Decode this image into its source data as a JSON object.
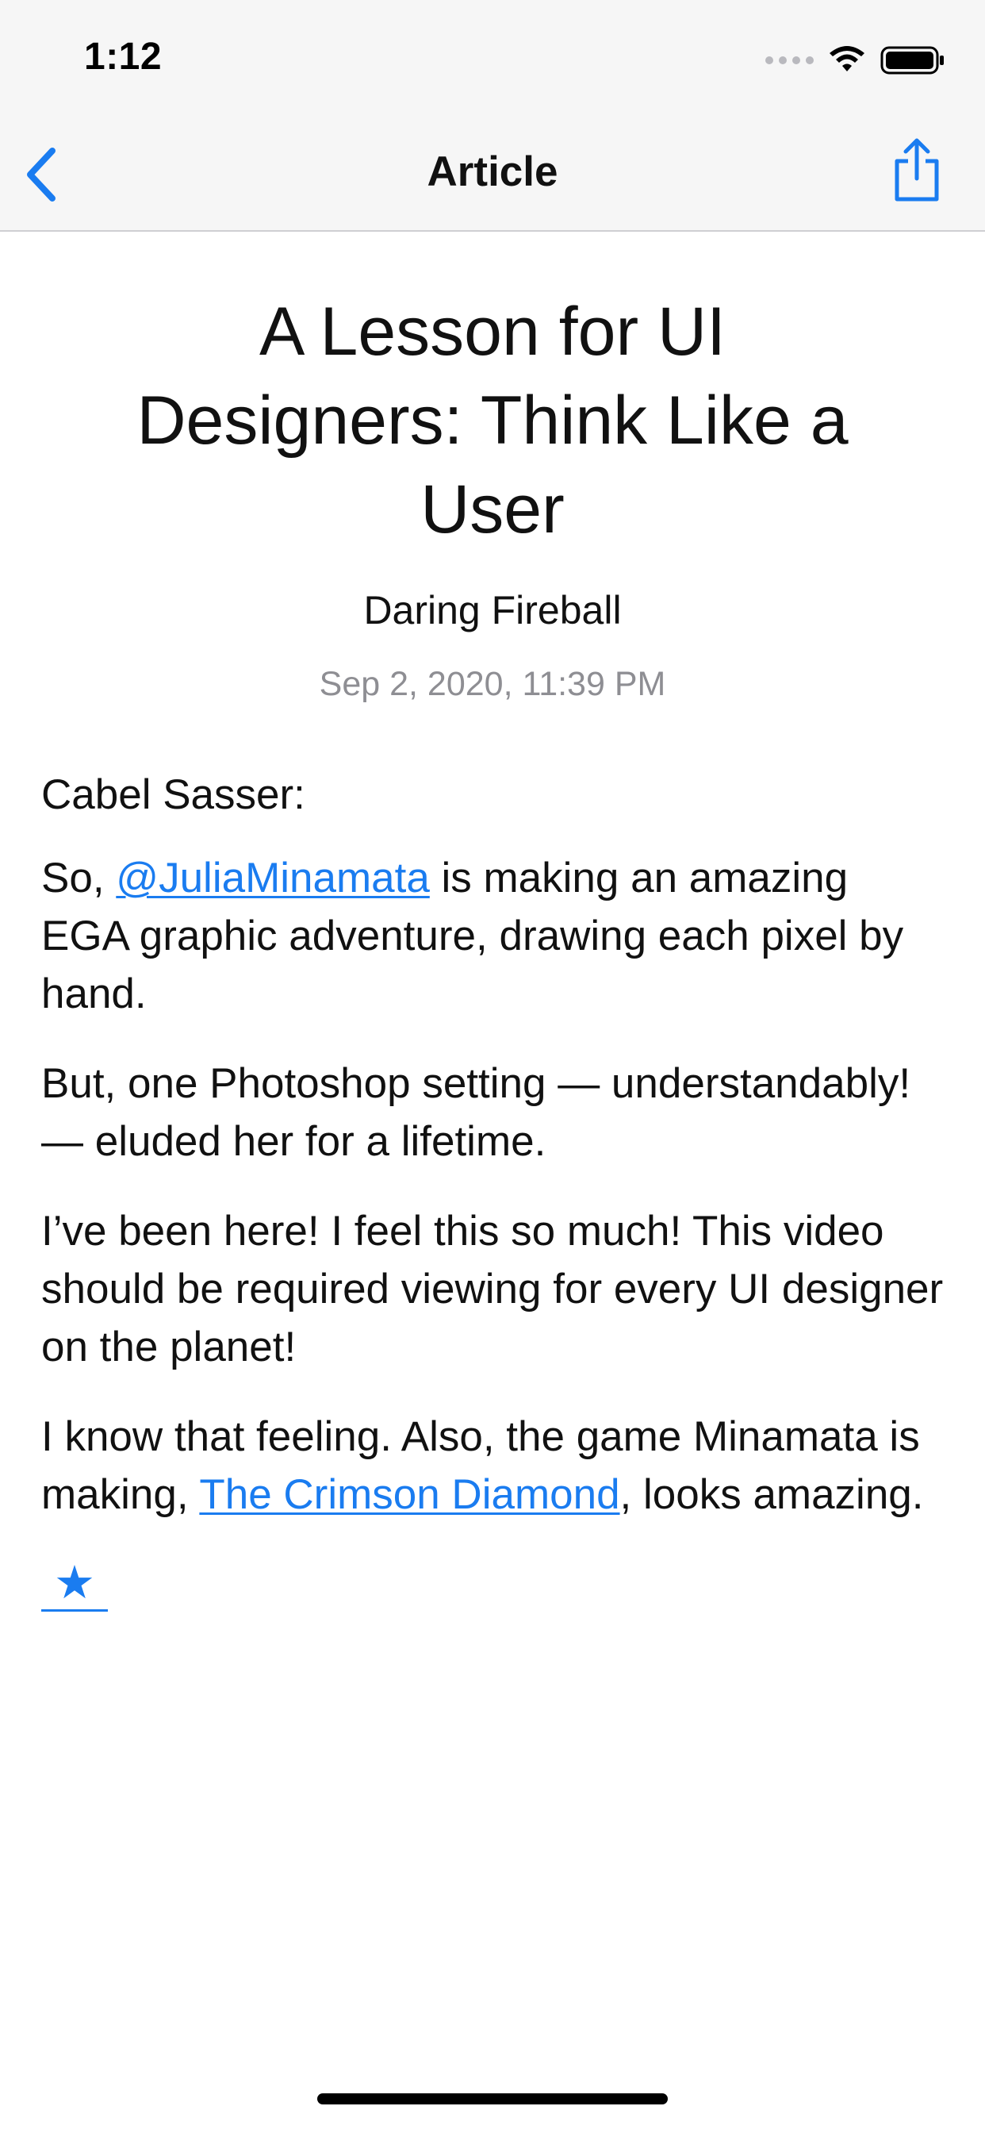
{
  "status_bar": {
    "time": "1:12",
    "icons": [
      "signal-dots-icon",
      "wifi-icon",
      "battery-icon"
    ]
  },
  "nav": {
    "back_icon": "chevron-left-icon",
    "title": "Article",
    "share_icon": "share-icon"
  },
  "article": {
    "title": "A Lesson for UI Designers: Think Like a User",
    "source": "Daring Fireball",
    "date": "Sep 2, 2020, 11:39 PM",
    "body": {
      "p1": "Cabel Sasser:",
      "p2_before": "So, ",
      "p2_link": "@JuliaMinamata",
      "p2_after": " is making an amazing EGA graphic adventure, drawing each pixel by hand.",
      "p3": "But, one Photoshop setting — understandably! — eluded her for a lifetime.",
      "p4": "I’ve been here! I feel this so much! This video should be required viewing for every UI designer on the planet!",
      "p5_before": "I know that feeling. Also, the game Minamata is making, ",
      "p5_link": "The Crimson Diamond",
      "p5_after": ", looks amazing.",
      "star": "★"
    }
  },
  "colors": {
    "accent": "#1a7cf0",
    "nav_background": "#f6f6f6",
    "secondary_text": "#8e8e93"
  }
}
